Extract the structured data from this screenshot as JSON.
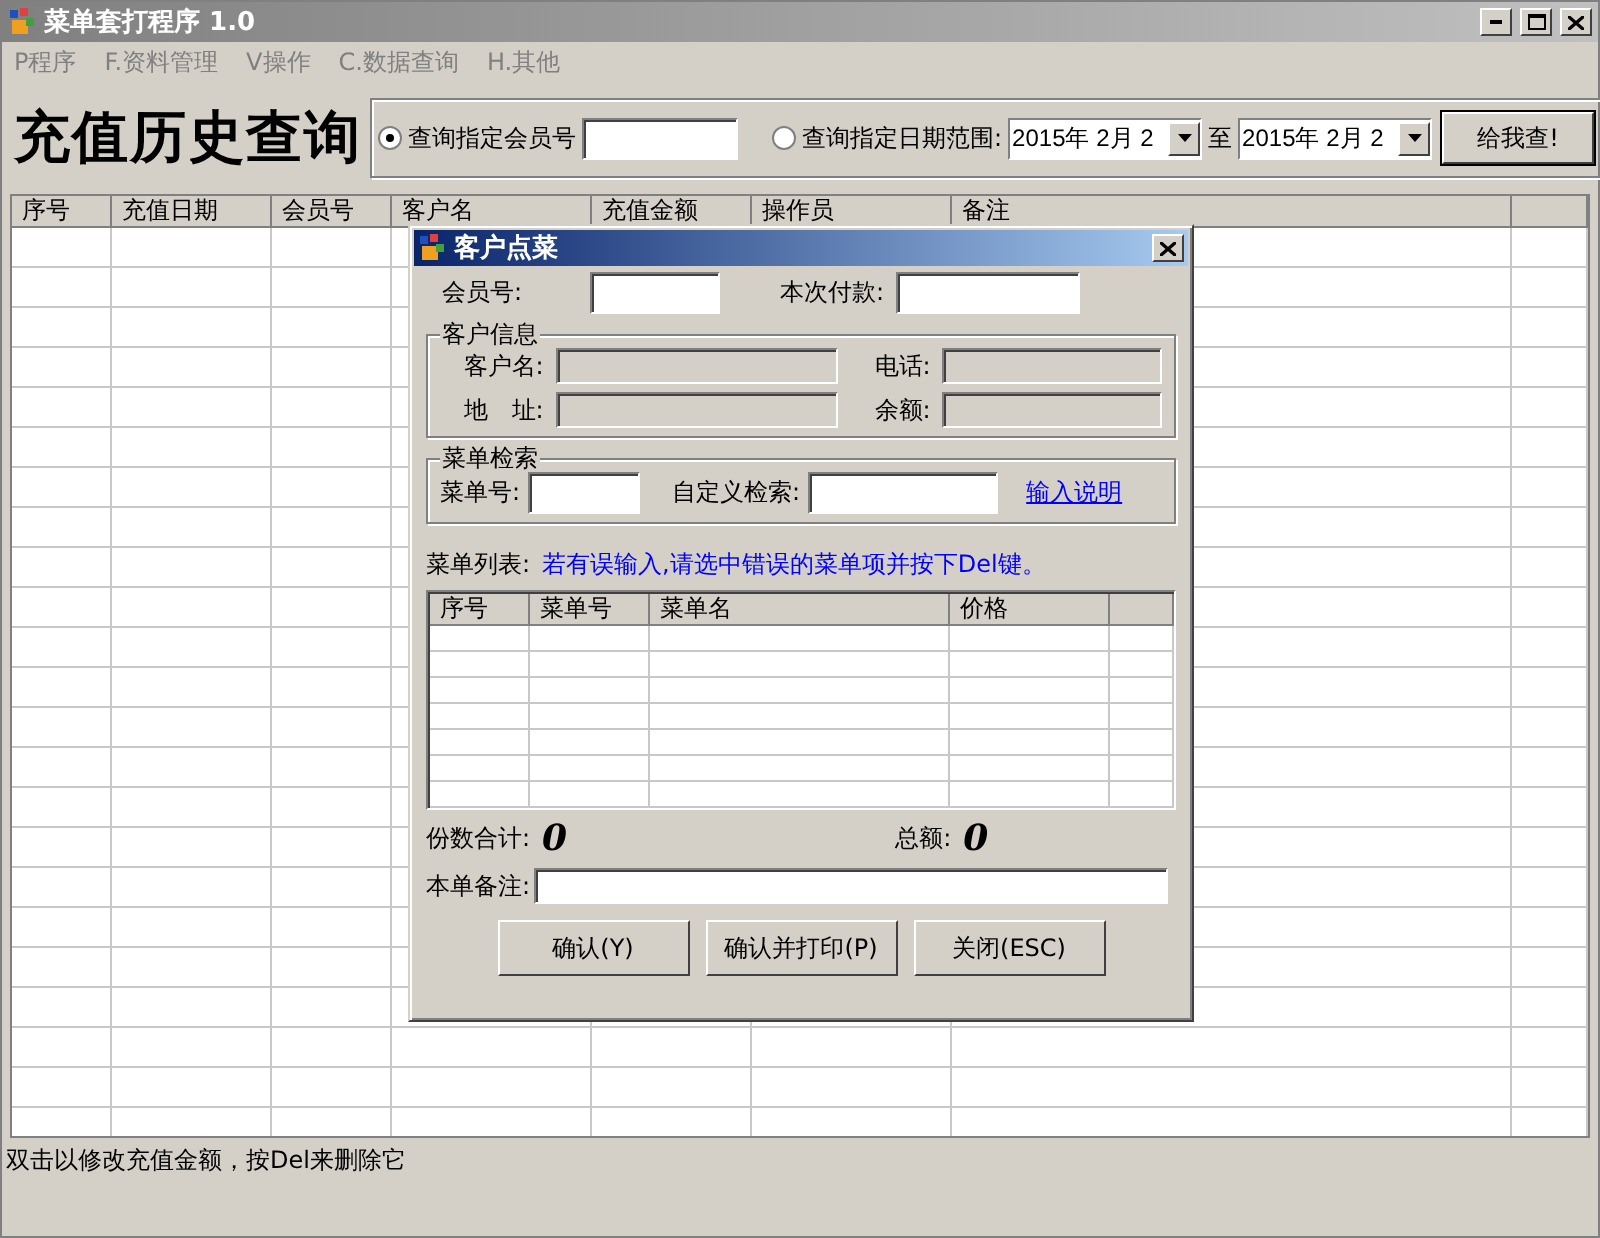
{
  "window": {
    "title": "菜单套打程序 1.0"
  },
  "menu": [
    {
      "label": "P程序"
    },
    {
      "label": "F.资料管理"
    },
    {
      "label": "V操作"
    },
    {
      "label": "C.数据查询"
    },
    {
      "label": "H.其他"
    }
  ],
  "page_title": "充值历史查询",
  "query": {
    "options": [
      {
        "label": "查询指定会员号",
        "selected": true
      },
      {
        "label": "查询指定日期范围:",
        "selected": false
      }
    ],
    "date_from": "2015年 2月 2",
    "range_separator": "至",
    "date_to": "2015年 2月 2",
    "button": "给我查!"
  },
  "table": {
    "columns": [
      "序号",
      "充值日期",
      "会员号",
      "客户名",
      "充值金额",
      "操作员",
      "备注"
    ]
  },
  "status_bar": "双击以修改充值金额，按Del来删除它",
  "dialog": {
    "title": "客户点菜",
    "member_label": "会员号:",
    "payment_label": "本次付款:",
    "customer_group": {
      "title": "客户信息",
      "fields": [
        {
          "label": "客户名:",
          "disabled": true
        },
        {
          "label": "电话:",
          "disabled": true
        },
        {
          "label": "地　址:",
          "disabled": true
        },
        {
          "label": "余额:",
          "disabled": true
        }
      ]
    },
    "search_group": {
      "title": "菜单检索",
      "menu_no_label": "菜单号:",
      "custom_label": "自定义检索:",
      "help_link": "输入说明"
    },
    "list_label": "菜单列表:",
    "list_hint": "若有误输入,请选中错误的菜单项并按下Del键。",
    "list_columns": [
      "序号",
      "菜单号",
      "菜单名",
      "价格"
    ],
    "count_label": "份数合计:",
    "count_value": "0",
    "total_label": "总额:",
    "total_value": "0",
    "note_label": "本单备注:",
    "buttons": [
      "确认(Y)",
      "确认并打印(P)",
      "关闭(ESC)"
    ]
  }
}
